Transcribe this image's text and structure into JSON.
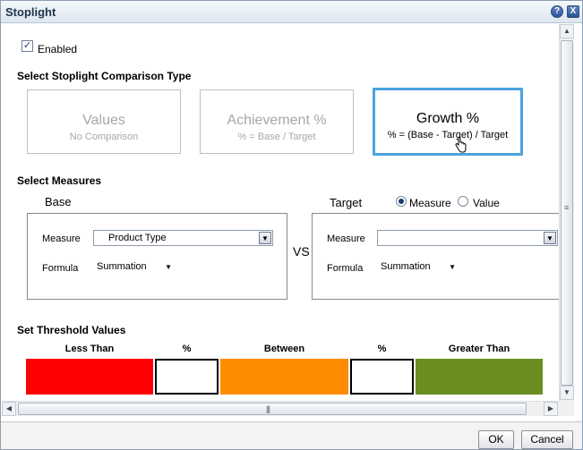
{
  "dialog": {
    "title": "Stoplight",
    "help_glyph": "?",
    "close_glyph": "X"
  },
  "enabled": {
    "label": "Enabled",
    "checked": true,
    "check_glyph": "✓"
  },
  "comparison": {
    "heading": "Select Stoplight Comparison Type",
    "options": [
      {
        "title": "Values",
        "subtitle": "No Comparison",
        "selected": false
      },
      {
        "title": "Achievement %",
        "subtitle": "% = Base / Target",
        "selected": false
      },
      {
        "title": "Growth %",
        "subtitle": "% = (Base - Target) / Target",
        "selected": true
      }
    ],
    "cursor_icon": "hand-pointer-icon"
  },
  "measures": {
    "heading": "Select Measures",
    "base": {
      "title": "Base",
      "measure_label": "Measure",
      "measure_value": "Product Type",
      "formula_label": "Formula",
      "formula_value": "Summation"
    },
    "vs": "VS",
    "target": {
      "title": "Target",
      "radio_measure": "Measure",
      "radio_value": "Value",
      "selected_radio": "Measure",
      "measure_label": "Measure",
      "measure_value": "",
      "formula_label": "Formula",
      "formula_value": "Summation"
    }
  },
  "threshold": {
    "heading": "Set Threshold Values",
    "labels": [
      "Less Than",
      "%",
      "Between",
      "%",
      "Greater Than"
    ],
    "colors": {
      "less_than": "#ff0000",
      "between": "#ff8c00",
      "greater_than": "#6b8e23"
    },
    "values": [
      "",
      ""
    ]
  },
  "scroll": {
    "grip_v": "≡",
    "grip_h": "|||",
    "up": "▲",
    "down": "▼",
    "left": "◀",
    "right": "▶",
    "dropdown": "▼"
  },
  "footer": {
    "ok": "OK",
    "cancel": "Cancel"
  }
}
